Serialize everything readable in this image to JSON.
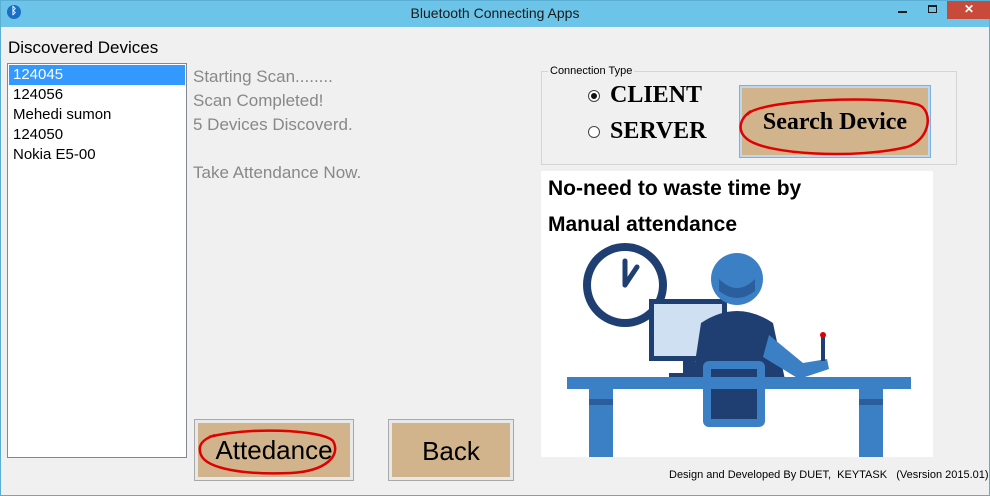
{
  "window": {
    "title": "Bluetooth Connecting Apps"
  },
  "devices": {
    "label": "Discovered Devices",
    "items": [
      "124045",
      "124056",
      "Mehedi sumon",
      "124050",
      "Nokia E5-00"
    ]
  },
  "status": {
    "lines": [
      "Starting Scan........",
      "Scan Completed!",
      "5 Devices Discoverd."
    ],
    "prompt": "Take Attendance Now."
  },
  "connection": {
    "legend": "Connection Type",
    "client_label": "CLIENT",
    "server_label": "SERVER",
    "selected": "CLIENT"
  },
  "buttons": {
    "search": "Search Device",
    "attendance": "Attedance",
    "back": "Back"
  },
  "promo": {
    "line1": "No-need to waste time by",
    "line2": "Manual attendance"
  },
  "footer": "Design and Developed By DUET,  KEYTASK   (Vesrsion 2015.01)",
  "colors": {
    "titlebar": "#6cc4e8",
    "button": "#d2b48c",
    "close": "#c74a3a",
    "selection": "#3399ff",
    "annotation": "#e00000",
    "illustration_blue": "#3b7fc4",
    "illustration_navy": "#1f3f72"
  }
}
